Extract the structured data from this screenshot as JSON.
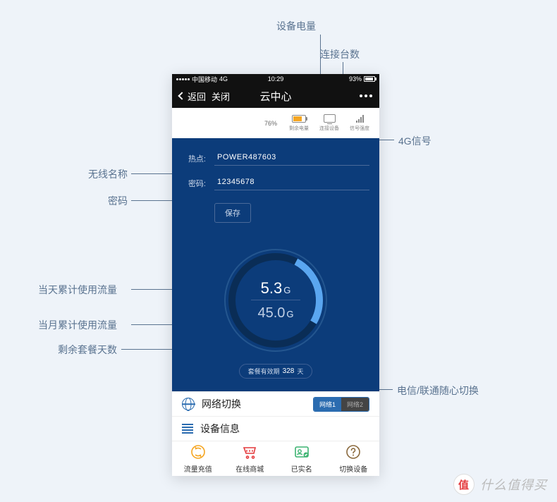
{
  "annotations": {
    "battery": "设备电量",
    "connections": "连接台数",
    "signal": "4G信号",
    "ssid": "无线名称",
    "password": "密码",
    "daily_usage": "当天累计使用流量",
    "monthly_usage": "当月累计使用流量",
    "remaining_days": "剩余套餐天数",
    "network_switch": "电信/联通随心切换"
  },
  "statusbar": {
    "carrier": "中国移动",
    "network": "4G",
    "time": "10:29",
    "battery_pct": "93%"
  },
  "navbar": {
    "back": "返回",
    "close": "关闭",
    "title": "云中心"
  },
  "top_status": {
    "battery_pct": "76%",
    "battery_label": "剩余电量",
    "device_label": "连接设备",
    "signal_label": "信号强度"
  },
  "wifi": {
    "ssid_label": "热点:",
    "ssid_value": "POWER487603",
    "pwd_label": "密码:",
    "pwd_value": "12345678",
    "save": "保存"
  },
  "gauge": {
    "daily_value": "5.3",
    "daily_unit": "G",
    "monthly_value": "45.0",
    "monthly_unit": "G",
    "validity_prefix": "套餐有效期",
    "validity_days": "328",
    "validity_suffix": "天"
  },
  "sections": {
    "network_switch": "网络切换",
    "net1": "网络1",
    "net2": "网络2",
    "device_info": "设备信息"
  },
  "tabs": {
    "recharge": "流量充值",
    "shop": "在线商城",
    "realname": "已实名",
    "switch_device": "切换设备"
  },
  "watermark": {
    "badge": "值",
    "text": "什么值得买"
  }
}
